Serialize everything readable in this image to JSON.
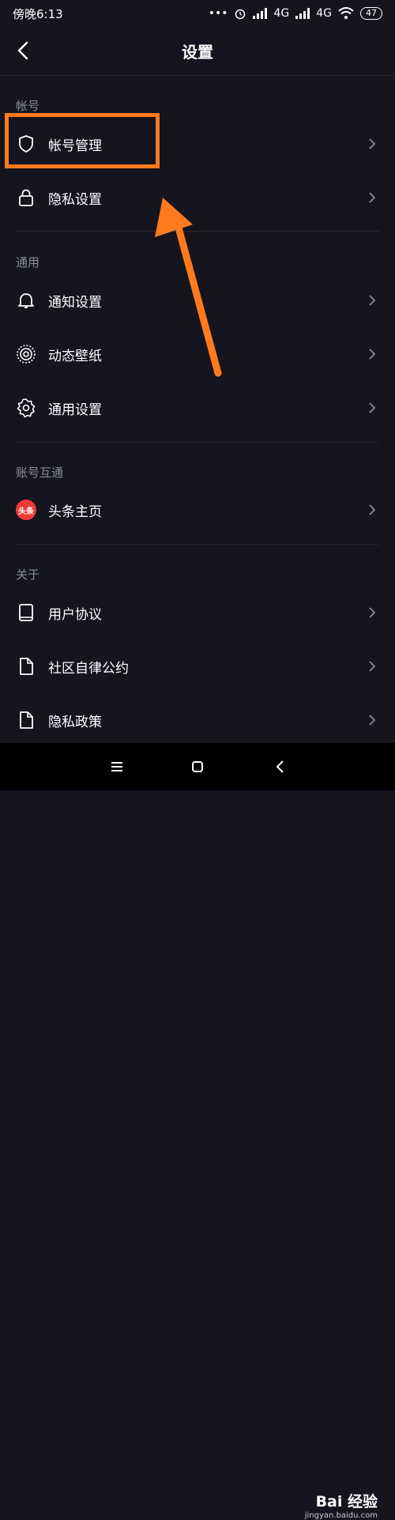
{
  "status": {
    "time": "傍晚6:13",
    "dots": "•••",
    "network1": "4G",
    "network2": "4G",
    "battery": "47"
  },
  "header": {
    "title": "设置"
  },
  "sections": {
    "account": {
      "title": "帐号",
      "items": [
        "帐号管理",
        "隐私设置"
      ]
    },
    "general": {
      "title": "通用",
      "items": [
        "通知设置",
        "动态壁纸",
        "通用设置"
      ]
    },
    "linked": {
      "title": "账号互通",
      "items": [
        "头条主页"
      ]
    },
    "about": {
      "title": "关于",
      "items": [
        "用户协议",
        "社区自律公约",
        "隐私政策"
      ]
    }
  },
  "toutiao_badge": "头条",
  "watermark": {
    "brand": "Bai 经验",
    "url": "jingyan.baidu.com"
  },
  "colors": {
    "background": "#14151f",
    "highlight": "#ff7a1c",
    "section_text": "#8c8d96"
  }
}
